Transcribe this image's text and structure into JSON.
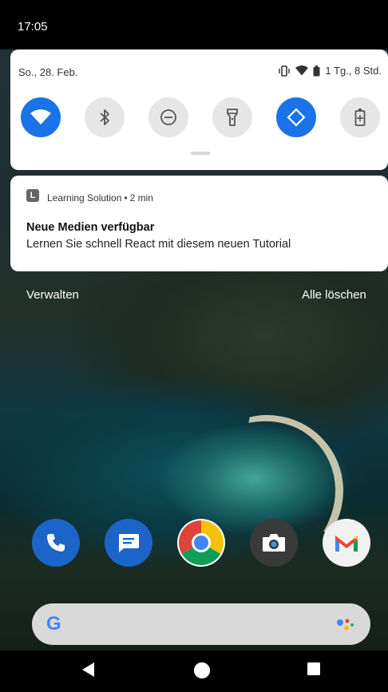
{
  "status_bar": {
    "time": "17:05"
  },
  "quick_settings": {
    "date": "So., 28. Feb.",
    "battery_text": "1 Tg., 8 Std.",
    "tiles": [
      {
        "name": "wifi",
        "icon": "wifi-icon",
        "active": true
      },
      {
        "name": "bluetooth",
        "icon": "bluetooth-icon",
        "active": false
      },
      {
        "name": "do-not-disturb",
        "icon": "do-not-disturb-icon",
        "active": false
      },
      {
        "name": "flashlight",
        "icon": "flashlight-icon",
        "active": false
      },
      {
        "name": "auto-rotate",
        "icon": "auto-rotate-icon",
        "active": true
      },
      {
        "name": "battery-saver",
        "icon": "battery-saver-icon",
        "active": false
      }
    ]
  },
  "notification": {
    "app_letter": "L",
    "app_name": "Learning Solution",
    "separator": "•",
    "time_ago": "2 min",
    "title": "Neue Medien verfügbar",
    "text": "Lernen Sie schnell React mit diesem neuen Tutorial"
  },
  "actions": {
    "manage": "Verwalten",
    "clear_all": "Alle löschen"
  },
  "dock": [
    {
      "name": "phone",
      "icon": "phone-icon"
    },
    {
      "name": "messages",
      "icon": "messages-icon"
    },
    {
      "name": "chrome",
      "icon": "chrome-icon"
    },
    {
      "name": "camera",
      "icon": "camera-icon"
    },
    {
      "name": "gmail",
      "icon": "gmail-icon"
    }
  ],
  "search": {
    "logo_letter": "G"
  },
  "colors": {
    "accent": "#1a73e8",
    "tile_off": "#e6e6e6"
  }
}
